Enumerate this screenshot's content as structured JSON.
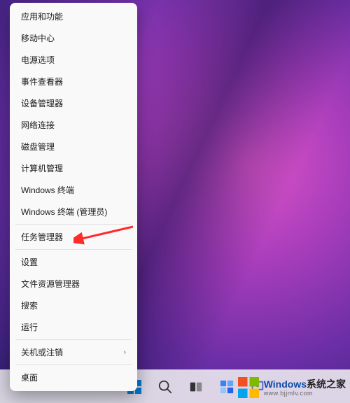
{
  "menu": {
    "items": [
      {
        "label": "应用和功能"
      },
      {
        "label": "移动中心"
      },
      {
        "label": "电源选项"
      },
      {
        "label": "事件查看器"
      },
      {
        "label": "设备管理器"
      },
      {
        "label": "网络连接"
      },
      {
        "label": "磁盘管理"
      },
      {
        "label": "计算机管理"
      },
      {
        "label": "Windows 终端"
      },
      {
        "label": "Windows 终端 (管理员)"
      }
    ],
    "group2": [
      {
        "label": "任务管理器"
      }
    ],
    "group3": [
      {
        "label": "设置"
      },
      {
        "label": "文件资源管理器"
      },
      {
        "label": "搜索"
      },
      {
        "label": "运行"
      }
    ],
    "group4": [
      {
        "label": "关机或注销",
        "submenu": true
      }
    ],
    "group5": [
      {
        "label": "桌面"
      }
    ]
  },
  "taskbar": {
    "start": "start-icon",
    "search": "search-icon",
    "taskview": "task-view-icon",
    "widgets": "widgets-icon",
    "chat": "chat-icon"
  },
  "watermark": {
    "brand": "Windows",
    "sub": "系统之家",
    "url": "www.bjjmlv.com"
  }
}
